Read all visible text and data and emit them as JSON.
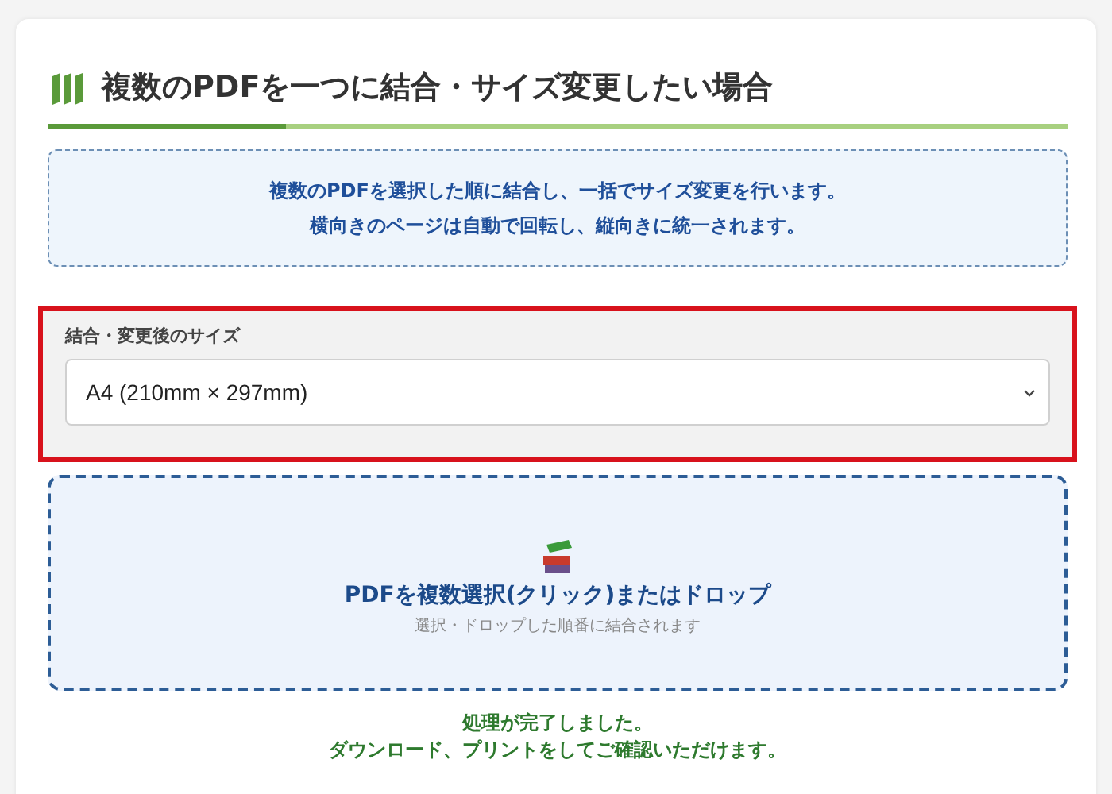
{
  "heading": {
    "title": "複数のPDFを一つに結合・サイズ変更したい場合"
  },
  "info": {
    "lines": [
      "複数のPDFを選択した順に結合し、一括でサイズ変更を行います。",
      "横向きのページは自動で回転し、縦向きに統一されます。"
    ]
  },
  "size_setting": {
    "label": "結合・変更後のサイズ",
    "value": "A4 (210mm × 297mm)",
    "highlighted": true
  },
  "dropzone": {
    "title": "PDFを複数選択(クリック)またはドロップ",
    "hint": "選択・ドロップした順番に結合されます"
  },
  "status": {
    "lines": [
      "処理が完了しました。",
      "ダウンロード、プリントをしてご確認いただけます。"
    ]
  }
}
